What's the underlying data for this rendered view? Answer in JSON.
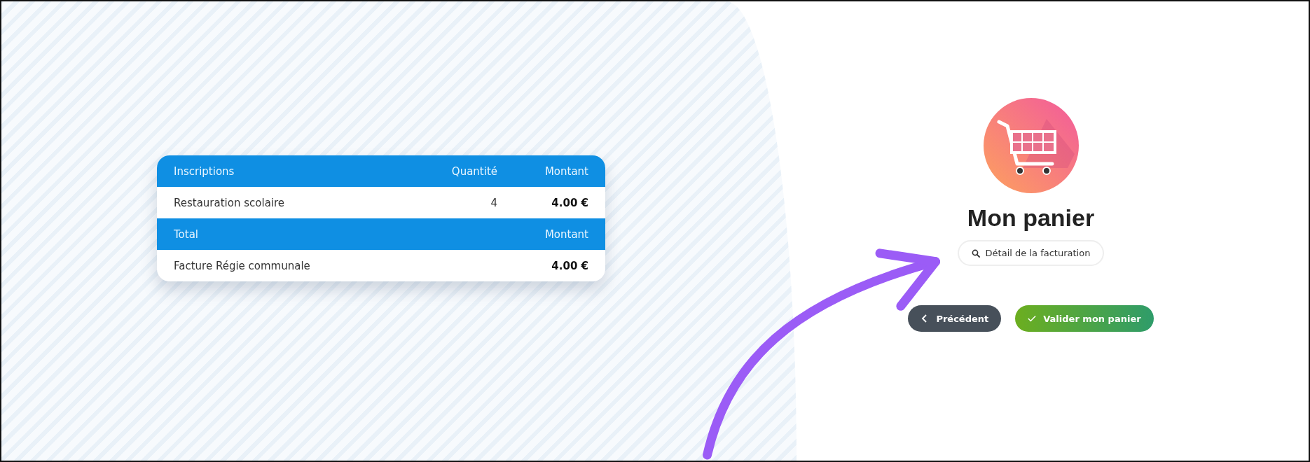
{
  "summary_table": {
    "sections": [
      {
        "columns": [
          "Inscriptions",
          "Quantité",
          "Montant"
        ],
        "rows": [
          [
            "Restauration scolaire",
            "4",
            "4.00 €"
          ]
        ]
      },
      {
        "columns": [
          "Total",
          "",
          "Montant"
        ],
        "rows": [
          [
            "Facture Régie communale",
            "",
            "4.00 €"
          ]
        ]
      }
    ]
  },
  "cart": {
    "title": "Mon panier",
    "detail_button": "Détail de la facturation",
    "buttons": [
      {
        "kind": "back",
        "label": "Précédent"
      },
      {
        "kind": "confirm",
        "label": "Valider mon panier"
      }
    ]
  }
}
